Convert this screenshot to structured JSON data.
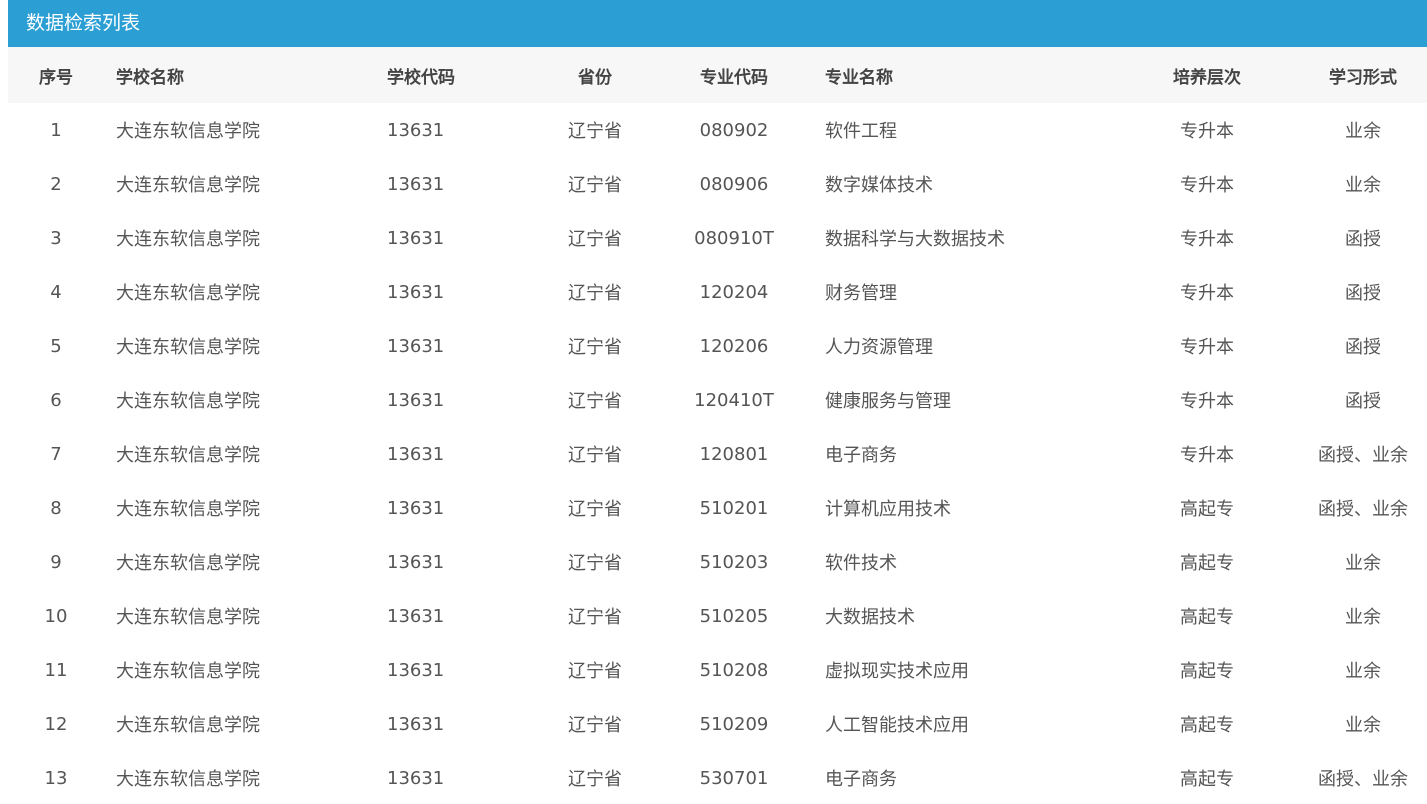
{
  "title": "数据检索列表",
  "columns": {
    "index": "序号",
    "school_name": "学校名称",
    "school_code": "学校代码",
    "province": "省份",
    "major_code": "专业代码",
    "major_name": "专业名称",
    "level": "培养层次",
    "study_form": "学习形式"
  },
  "rows": [
    {
      "index": "1",
      "school_name": "大连东软信息学院",
      "school_code": "13631",
      "province": "辽宁省",
      "major_code": "080902",
      "major_name": "软件工程",
      "level": "专升本",
      "study_form": "业余"
    },
    {
      "index": "2",
      "school_name": "大连东软信息学院",
      "school_code": "13631",
      "province": "辽宁省",
      "major_code": "080906",
      "major_name": "数字媒体技术",
      "level": "专升本",
      "study_form": "业余"
    },
    {
      "index": "3",
      "school_name": "大连东软信息学院",
      "school_code": "13631",
      "province": "辽宁省",
      "major_code": "080910T",
      "major_name": "数据科学与大数据技术",
      "level": "专升本",
      "study_form": "函授"
    },
    {
      "index": "4",
      "school_name": "大连东软信息学院",
      "school_code": "13631",
      "province": "辽宁省",
      "major_code": "120204",
      "major_name": "财务管理",
      "level": "专升本",
      "study_form": "函授"
    },
    {
      "index": "5",
      "school_name": "大连东软信息学院",
      "school_code": "13631",
      "province": "辽宁省",
      "major_code": "120206",
      "major_name": "人力资源管理",
      "level": "专升本",
      "study_form": "函授"
    },
    {
      "index": "6",
      "school_name": "大连东软信息学院",
      "school_code": "13631",
      "province": "辽宁省",
      "major_code": "120410T",
      "major_name": "健康服务与管理",
      "level": "专升本",
      "study_form": "函授"
    },
    {
      "index": "7",
      "school_name": "大连东软信息学院",
      "school_code": "13631",
      "province": "辽宁省",
      "major_code": "120801",
      "major_name": "电子商务",
      "level": "专升本",
      "study_form": "函授、业余"
    },
    {
      "index": "8",
      "school_name": "大连东软信息学院",
      "school_code": "13631",
      "province": "辽宁省",
      "major_code": "510201",
      "major_name": "计算机应用技术",
      "level": "高起专",
      "study_form": "函授、业余"
    },
    {
      "index": "9",
      "school_name": "大连东软信息学院",
      "school_code": "13631",
      "province": "辽宁省",
      "major_code": "510203",
      "major_name": "软件技术",
      "level": "高起专",
      "study_form": "业余"
    },
    {
      "index": "10",
      "school_name": "大连东软信息学院",
      "school_code": "13631",
      "province": "辽宁省",
      "major_code": "510205",
      "major_name": "大数据技术",
      "level": "高起专",
      "study_form": "业余"
    },
    {
      "index": "11",
      "school_name": "大连东软信息学院",
      "school_code": "13631",
      "province": "辽宁省",
      "major_code": "510208",
      "major_name": "虚拟现实技术应用",
      "level": "高起专",
      "study_form": "业余"
    },
    {
      "index": "12",
      "school_name": "大连东软信息学院",
      "school_code": "13631",
      "province": "辽宁省",
      "major_code": "510209",
      "major_name": "人工智能技术应用",
      "level": "高起专",
      "study_form": "业余"
    },
    {
      "index": "13",
      "school_name": "大连东软信息学院",
      "school_code": "13631",
      "province": "辽宁省",
      "major_code": "530701",
      "major_name": "电子商务",
      "level": "高起专",
      "study_form": "函授、业余"
    }
  ]
}
